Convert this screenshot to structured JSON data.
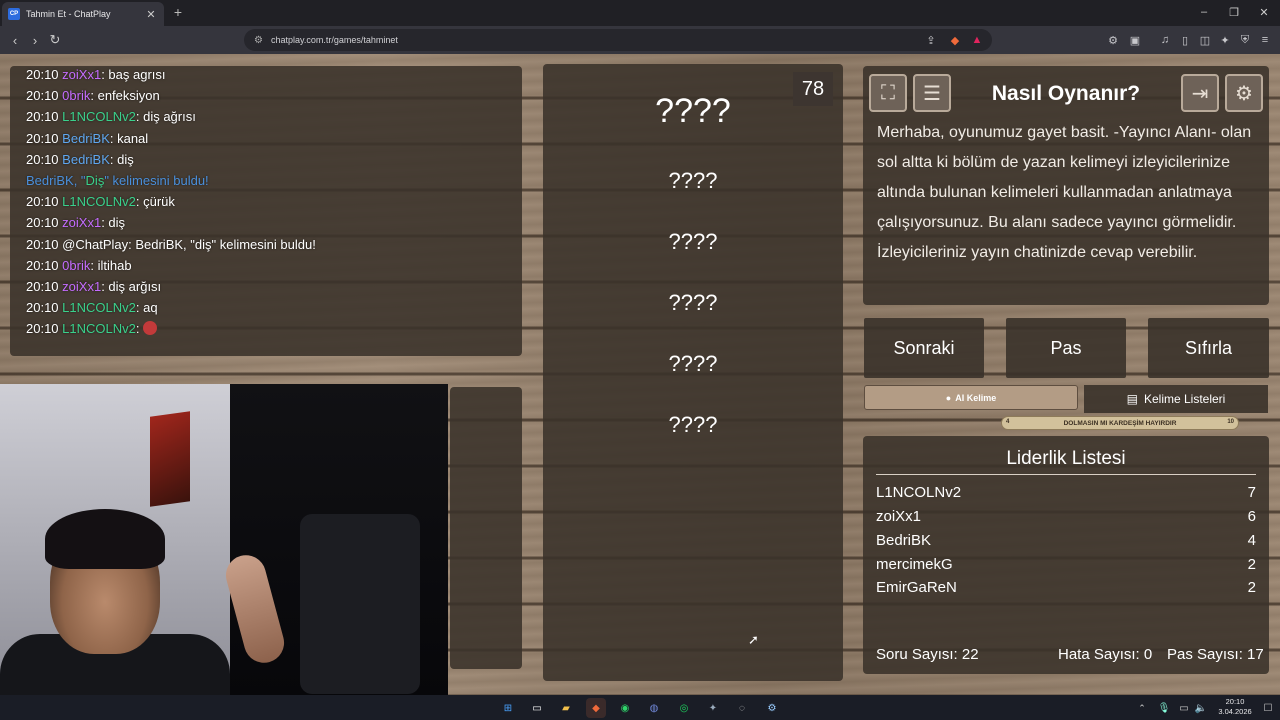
{
  "browser": {
    "tab_title": "Tahmin Et - ChatPlay",
    "tab_favicon": "CP",
    "url": "chatplay.com.tr/games/tahminet"
  },
  "chat": [
    {
      "time": "20:10",
      "user": "zoiXx1",
      "color": "purple",
      "msg": ": baş agrısı"
    },
    {
      "time": "20:10",
      "user": "0brik",
      "color": "purple",
      "msg": ": enfeksiyon"
    },
    {
      "time": "20:10",
      "user": "L1NCOLNv2",
      "color": "green",
      "msg": ": diş ağrısı"
    },
    {
      "time": "20:10",
      "user": "BedriBK",
      "color": "blue",
      "msg": ": kanal"
    },
    {
      "time": "20:10",
      "user": "BedriBK",
      "color": "blue",
      "msg": ": diş"
    }
  ],
  "notice": {
    "user": "BedriBK",
    "pre": ", \"",
    "word": "Diş",
    "post": "\" kelimesini buldu!"
  },
  "chat2": [
    {
      "time": "20:10",
      "user": "L1NCOLNv2",
      "color": "green",
      "msg": ": çürük"
    },
    {
      "time": "20:10",
      "user": "zoiXx1",
      "color": "purple",
      "msg": ": diş"
    },
    {
      "time": "20:10",
      "user": "",
      "color": "gray",
      "msg": "@ChatPlay: BedriBK, \"diş\" kelimesini buldu!"
    },
    {
      "time": "20:10",
      "user": "0brik",
      "color": "purple",
      "msg": ": iltihab"
    },
    {
      "time": "20:10",
      "user": "zoiXx1",
      "color": "purple",
      "msg": ": diş arğısı"
    },
    {
      "time": "20:10",
      "user": "L1NCOLNv2",
      "color": "green",
      "msg": ": aq"
    },
    {
      "time": "20:10",
      "user": "L1NCOLNv2",
      "color": "green",
      "msg": ":"
    }
  ],
  "game": {
    "timer": "78",
    "main_word": "????",
    "taboo_words": [
      "????",
      "????",
      "????",
      "????",
      "????"
    ]
  },
  "how": {
    "title": "Nasıl Oynanır?",
    "text": "Merhaba, oyunumuz gayet basit. -Yayıncı Alanı- olan sol altta ki bölüm de yazan kelimeyi izleyicilerinize altında bulunan kelimeleri kullanmadan anlatmaya çalışıyorsunuz. Bu alanı sadece yayıncı görmelidir. İzleyicileriniz yayın chatinizde cevap verebilir."
  },
  "actions": {
    "next": "Sonraki",
    "pass": "Pas",
    "reset": "Sıfırla"
  },
  "ai_button": "AI Kelime",
  "lists_button": "Kelime Listeleri",
  "progress": {
    "label": "DOLMASIN MI KARDEŞİM HAYIRDIR",
    "min": "4",
    "max": "10"
  },
  "leaderboard": {
    "title": "Liderlik Listesi",
    "rows": [
      {
        "name": "L1NCOLNv2",
        "score": "7"
      },
      {
        "name": "zoiXx1",
        "score": "6"
      },
      {
        "name": "BedriBK",
        "score": "4"
      },
      {
        "name": "mercimekG",
        "score": "2"
      },
      {
        "name": "EmirGaReN",
        "score": "2"
      }
    ]
  },
  "stats": {
    "questions": "Soru Sayısı: 22",
    "errors": "Hata Sayısı: 0",
    "passes": "Pas Sayısı: 17"
  },
  "clock": {
    "time": "20:10",
    "date": "3.04.2026"
  }
}
